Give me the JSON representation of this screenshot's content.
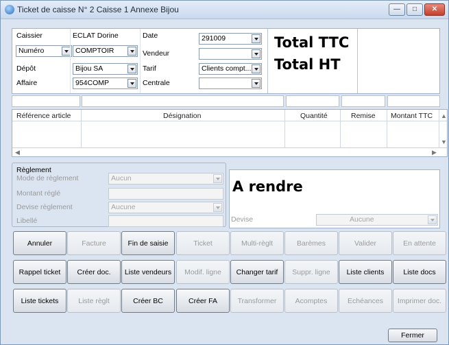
{
  "window": {
    "title": "Ticket de caisse N° 2 Caisse 1 Annexe Bijou",
    "buttons": {
      "minimize": "—",
      "maximize": "□",
      "close": "✕"
    }
  },
  "header": {
    "caissier_label": "Caissier",
    "caissier_value": "ECLAT Dorine",
    "numero_value": "Numéro",
    "comptoir_value": "COMPTOIR",
    "depot_label": "Dépôt",
    "depot_value": "Bijou SA",
    "affaire_label": "Affaire",
    "affaire_value": "954COMP",
    "date_label": "Date",
    "date_value": "291009",
    "vendeur_label": "Vendeur",
    "vendeur_value": "",
    "tarif_label": "Tarif",
    "tarif_value": "Clients compt...",
    "centrale_label": "Centrale",
    "centrale_value": "",
    "total_ttc": "Total TTC",
    "total_ht": "Total HT"
  },
  "grid": {
    "columns": [
      "Référence article",
      "Désignation",
      "Quantité",
      "Remise",
      "Montant TTC"
    ]
  },
  "reglement": {
    "title": "Règlement",
    "mode_label": "Mode de règlement",
    "mode_value": "Aucun",
    "montant_label": "Montant réglé",
    "devise_label": "Devise règlement",
    "devise_value": "Aucune",
    "libelle_label": "Libellé",
    "a_rendre": "A rendre",
    "devise2_label": "Devise",
    "devise2_value": "Aucune"
  },
  "buttons": {
    "row1": [
      "Annuler",
      "Facture",
      "Fin de saisie",
      "Ticket",
      "Multi-règlt",
      "Barèmes",
      "Valider",
      "En attente"
    ],
    "row2": [
      "Rappel ticket",
      "Créer doc.",
      "Liste vendeurs",
      "Modif. ligne",
      "Changer tarif",
      "Suppr. ligne",
      "Liste clients",
      "Liste docs"
    ],
    "row3": [
      "Liste tickets",
      "Liste règlt",
      "Créer BC",
      "Créer FA",
      "Transformer",
      "Acomptes",
      "Echéances",
      "Imprimer doc."
    ],
    "fermer": "Fermer"
  },
  "state": {
    "row1_enabled": [
      true,
      false,
      true,
      false,
      false,
      false,
      false,
      false
    ],
    "row2_enabled": [
      true,
      true,
      true,
      false,
      true,
      false,
      true,
      true
    ],
    "row3_enabled": [
      true,
      false,
      true,
      true,
      false,
      false,
      false,
      false
    ]
  }
}
